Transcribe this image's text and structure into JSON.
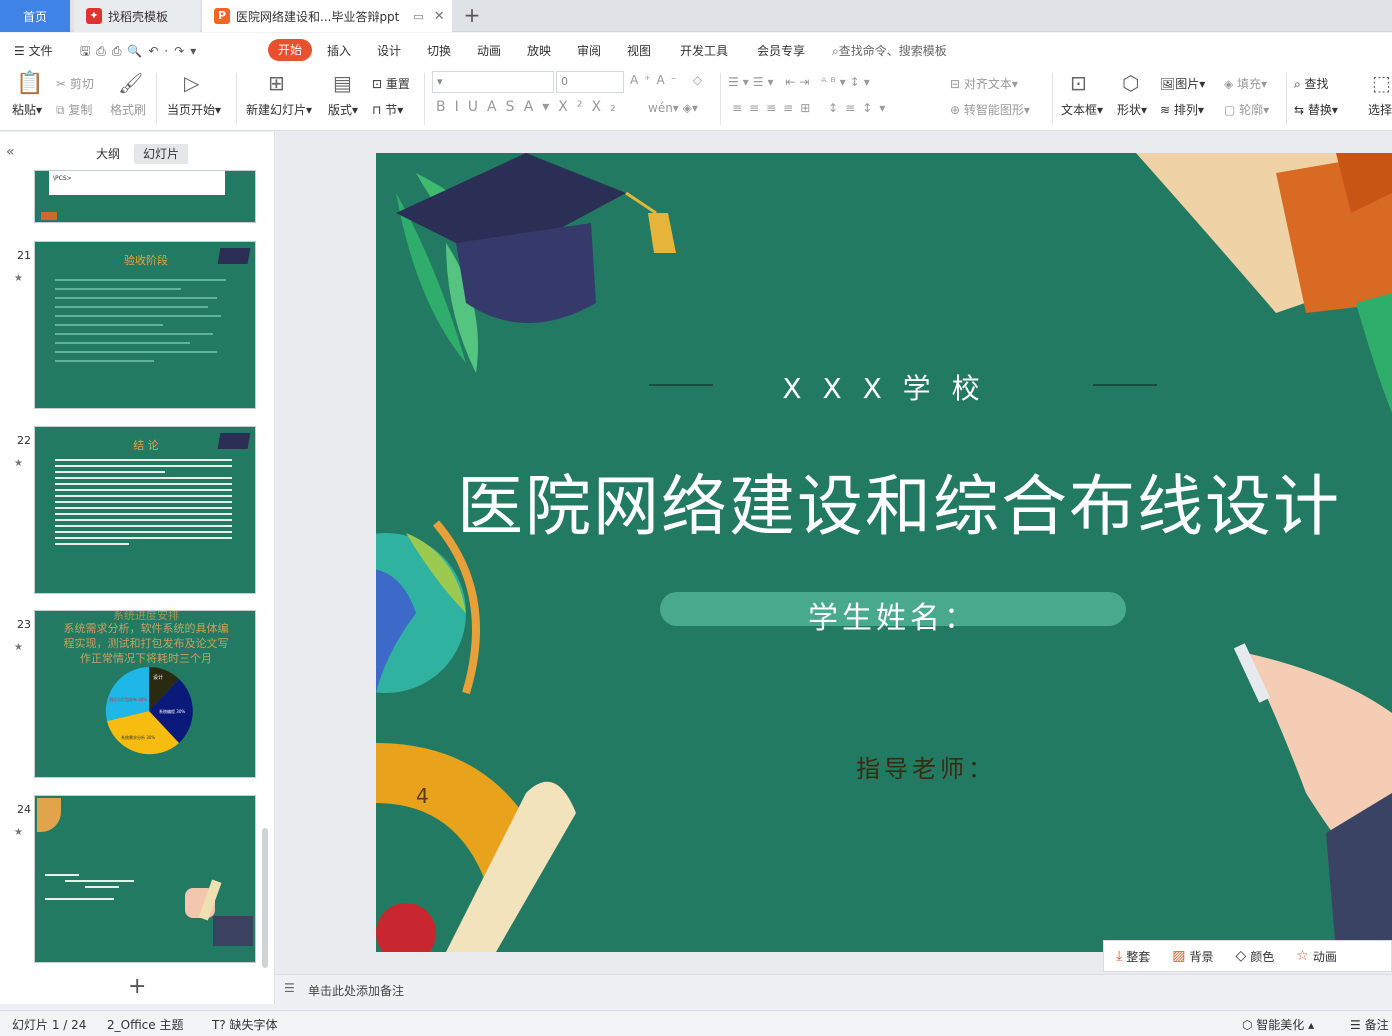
{
  "tabs": {
    "home": "首页",
    "template": "找稻壳模板",
    "document": "医院网络建设和...毕业答辩ppt",
    "add": "+"
  },
  "menu": {
    "file": "文件",
    "items": [
      "开始",
      "插入",
      "设计",
      "切换",
      "动画",
      "放映",
      "审阅",
      "视图",
      "开发工具",
      "会员专享"
    ],
    "search": "查找命令、搜索模板"
  },
  "ribbon": {
    "paste": "粘贴",
    "cut": "剪切",
    "copy": "复制",
    "format_painter": "格式刷",
    "from_current": "当页开始",
    "new_slide": "新建幻灯片",
    "layout": "版式",
    "section": "节",
    "reset": "重置",
    "font_size": "0",
    "align_text": "对齐文本",
    "smart_art": "转智能图形",
    "text_box": "文本框",
    "shape": "形状",
    "picture": "图片",
    "arrange": "排列",
    "fill": "填充",
    "outline": "轮廓",
    "find": "查找",
    "replace": "替换",
    "select": "选择"
  },
  "panel": {
    "outline_tab": "大纲",
    "slides_tab": "幻灯片",
    "add_slide": "+"
  },
  "thumbs": [
    {
      "num": "",
      "title": "",
      "text": "\\PCS>"
    },
    {
      "num": "21",
      "title": "验收阶段"
    },
    {
      "num": "22",
      "title": "结    论"
    },
    {
      "num": "23",
      "title": "系统进度安排",
      "lines": [
        "系统需求分析，软件系统的具体编",
        "程实现，测试和打包发布及论文写",
        "作正常情况下将耗时三个月"
      ]
    },
    {
      "num": "24",
      "title": ""
    }
  ],
  "pie": {
    "labels": [
      "设计",
      "测试与打包发布 30%",
      "系统编程 30%",
      "系统需求分析 30%"
    ]
  },
  "slide": {
    "school": "X X X 学 校",
    "title": "医院网络建设和综合布线设计",
    "student": "学生姓名：",
    "teacher": "指导老师："
  },
  "notes": {
    "placeholder": "单击此处添加备注"
  },
  "slide_tools": {
    "fit": "整套",
    "background": "背景",
    "color": "颜色",
    "animation": "动画"
  },
  "status": {
    "slide": "幻灯片 1 / 24",
    "theme": "2_Office 主题",
    "missing_font": "缺失字体",
    "beautify": "智能美化",
    "notes": "备注"
  },
  "colors": {
    "slide_bg": "#237a62",
    "accent": "#e8512e",
    "tab_blue": "#3f83e6"
  }
}
